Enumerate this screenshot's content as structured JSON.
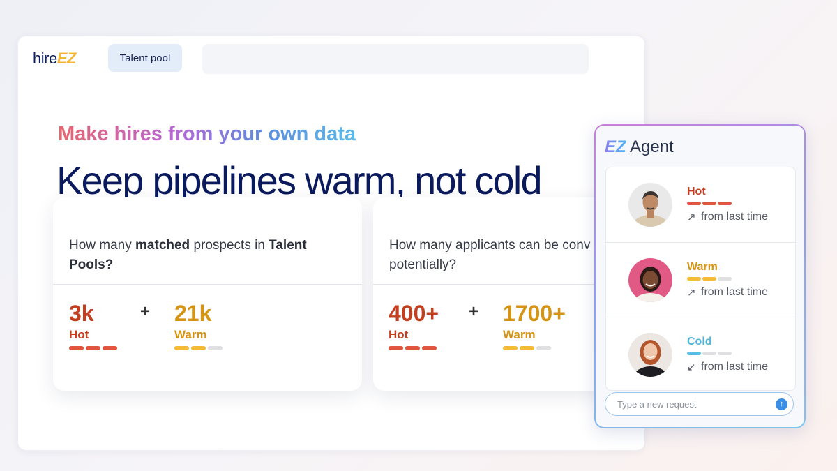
{
  "app": {
    "logo_hire": "hire",
    "logo_ez": "EZ",
    "tab_label": "Talent pool"
  },
  "hero": {
    "eyebrow": "Make hires from your own data",
    "headline": "Keep pipelines warm, not cold"
  },
  "cards": [
    {
      "question_parts": [
        "How many ",
        "matched",
        " prospects in ",
        "Talent",
        "Pools?"
      ],
      "hot_value": "3k",
      "hot_label": "Hot",
      "plus": "+",
      "warm_value": "21k",
      "warm_label": "Warm",
      "hot_bars_filled": 3,
      "warm_bars_filled": 2
    },
    {
      "question_line1": "How many applicants can be conv",
      "question_line2": "potentially?",
      "hot_value": "400+",
      "hot_label": "Hot",
      "plus": "+",
      "warm_value": "1700+",
      "warm_label": "Warm",
      "hot_bars_filled": 3,
      "warm_bars_filled": 2
    }
  ],
  "agent": {
    "title_ez": "EZ",
    "title_rest": " Agent",
    "candidates": [
      {
        "status": "Hot",
        "trend": "from last time",
        "trend_icon": "arrow-up-right-icon",
        "color": "#c2401f",
        "bar_color": "#e0553f",
        "bars_filled": 3
      },
      {
        "status": "Warm",
        "trend": "from last time",
        "trend_icon": "arrow-up-right-icon",
        "color": "#d69414",
        "bar_color": "#f3bb36",
        "bars_filled": 2
      },
      {
        "status": "Cold",
        "trend": "from last time",
        "trend_icon": "arrow-down-left-icon",
        "color": "#4fb3dc",
        "bar_color": "#56bfe5",
        "bars_filled": 1
      }
    ],
    "input_placeholder": "Type a new request"
  }
}
